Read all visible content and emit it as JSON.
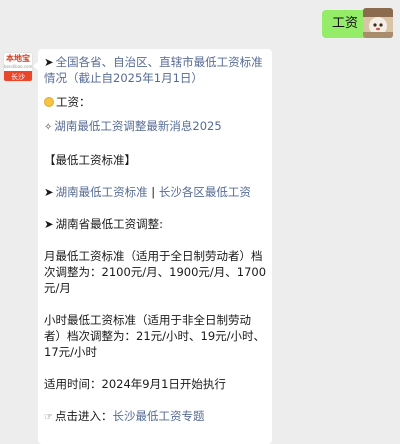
{
  "outgoing": {
    "text": "工资"
  },
  "avatar_left": {
    "logo_text": "本地宝",
    "logo_subtext": "bendibao.com",
    "city": "长沙"
  },
  "message": {
    "line1a": "全国各省、自治区、直辖市最低工资标准",
    "line1b": "情况（截止自2025年1月1日）",
    "salary_label": "工资：",
    "link_hunan_latest": "湖南最低工资调整最新消息2025",
    "section_title": "【最低工资标准】",
    "link_hunan_standard": "湖南最低工资标准",
    "separator": " | ",
    "link_changsha_areas": "长沙各区最低工资",
    "hunan_adjust_title": "湖南省最低工资调整:",
    "monthly_1": "月最低工资标准（适用于全日制劳动者）档",
    "monthly_2": "次调整为：2100元/月、1900元/月、1700",
    "monthly_3": "元/月",
    "hourly_1": "小时最低工资标准（适用于非全日制劳动",
    "hourly_2": "者）档次调整为：21元/小时、19元/小时、",
    "hourly_3": "17元/小时",
    "effective": "适用时间：2024年9月1日开始执行",
    "click_prefix": "点击进入：",
    "link_topic": "长沙最低工资专题"
  },
  "colors": {
    "link": "#576b95",
    "bubble_out": "#95ec69",
    "bubble_in": "#ffffff",
    "background": "#ededed"
  }
}
